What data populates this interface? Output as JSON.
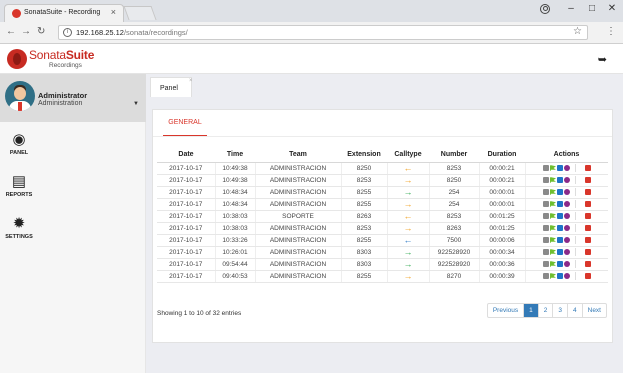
{
  "browser": {
    "tab_title": "SonataSuite - Recording",
    "url_host": "192.168.25.12",
    "url_path": "/sonata/recordings/"
  },
  "app": {
    "logo_text_a": "Sonata",
    "logo_text_b": "Suite",
    "logo_sub": "Recordings"
  },
  "sidebar": {
    "user_name": "Administrator",
    "user_role": "Administration",
    "items": [
      {
        "label": "PANEL",
        "icon": "dashboard-icon"
      },
      {
        "label": "REPORTS",
        "icon": "list-icon"
      },
      {
        "label": "SETTINGS",
        "icon": "gear-icon"
      }
    ]
  },
  "main": {
    "tab_label": "Panel",
    "subtab_label": "GENERAL",
    "columns": [
      "Date",
      "Time",
      "Team",
      "Extension",
      "Calltype",
      "Number",
      "Duration",
      "Actions"
    ],
    "rows": [
      {
        "date": "2017-10-17",
        "time": "10:49:38",
        "team": "ADMINISTRACION",
        "ext": "8250",
        "calltype": "incoming",
        "number": "8253",
        "duration": "00:00:21"
      },
      {
        "date": "2017-10-17",
        "time": "10:49:38",
        "team": "ADMINISTRACION",
        "ext": "8253",
        "calltype": "outgoing",
        "number": "8250",
        "duration": "00:00:21"
      },
      {
        "date": "2017-10-17",
        "time": "10:48:34",
        "team": "ADMINISTRACION",
        "ext": "8255",
        "calltype": "outgoing-green",
        "number": "254",
        "duration": "00:00:01"
      },
      {
        "date": "2017-10-17",
        "time": "10:48:34",
        "team": "ADMINISTRACION",
        "ext": "8255",
        "calltype": "outgoing",
        "number": "254",
        "duration": "00:00:01"
      },
      {
        "date": "2017-10-17",
        "time": "10:38:03",
        "team": "SOPORTE",
        "ext": "8263",
        "calltype": "incoming",
        "number": "8253",
        "duration": "00:01:25"
      },
      {
        "date": "2017-10-17",
        "time": "10:38:03",
        "team": "ADMINISTRACION",
        "ext": "8253",
        "calltype": "outgoing",
        "number": "8263",
        "duration": "00:01:25"
      },
      {
        "date": "2017-10-17",
        "time": "10:33:26",
        "team": "ADMINISTRACION",
        "ext": "8255",
        "calltype": "incoming-blue",
        "number": "7500",
        "duration": "00:00:06"
      },
      {
        "date": "2017-10-17",
        "time": "10:26:01",
        "team": "ADMINISTRACION",
        "ext": "8303",
        "calltype": "outgoing-green",
        "number": "922528920",
        "duration": "00:00:34"
      },
      {
        "date": "2017-10-17",
        "time": "09:54:44",
        "team": "ADMINISTRACION",
        "ext": "8303",
        "calltype": "outgoing-green",
        "number": "922528920",
        "duration": "00:00:36"
      },
      {
        "date": "2017-10-17",
        "time": "09:40:53",
        "team": "ADMINISTRACION",
        "ext": "8255",
        "calltype": "outgoing",
        "number": "8270",
        "duration": "00:00:39"
      }
    ],
    "showing_text": "Showing 1 to 10 of 32 entries",
    "pager": {
      "prev": "Previous",
      "pages": [
        "1",
        "2",
        "3",
        "4"
      ],
      "next": "Next",
      "active": "1"
    }
  },
  "colors": {
    "brand_red": "#c72b22",
    "calltype_orange": "#f0a020",
    "calltype_green": "#2ea84f",
    "calltype_blue": "#2b78c5",
    "pager_active": "#337ab7"
  }
}
